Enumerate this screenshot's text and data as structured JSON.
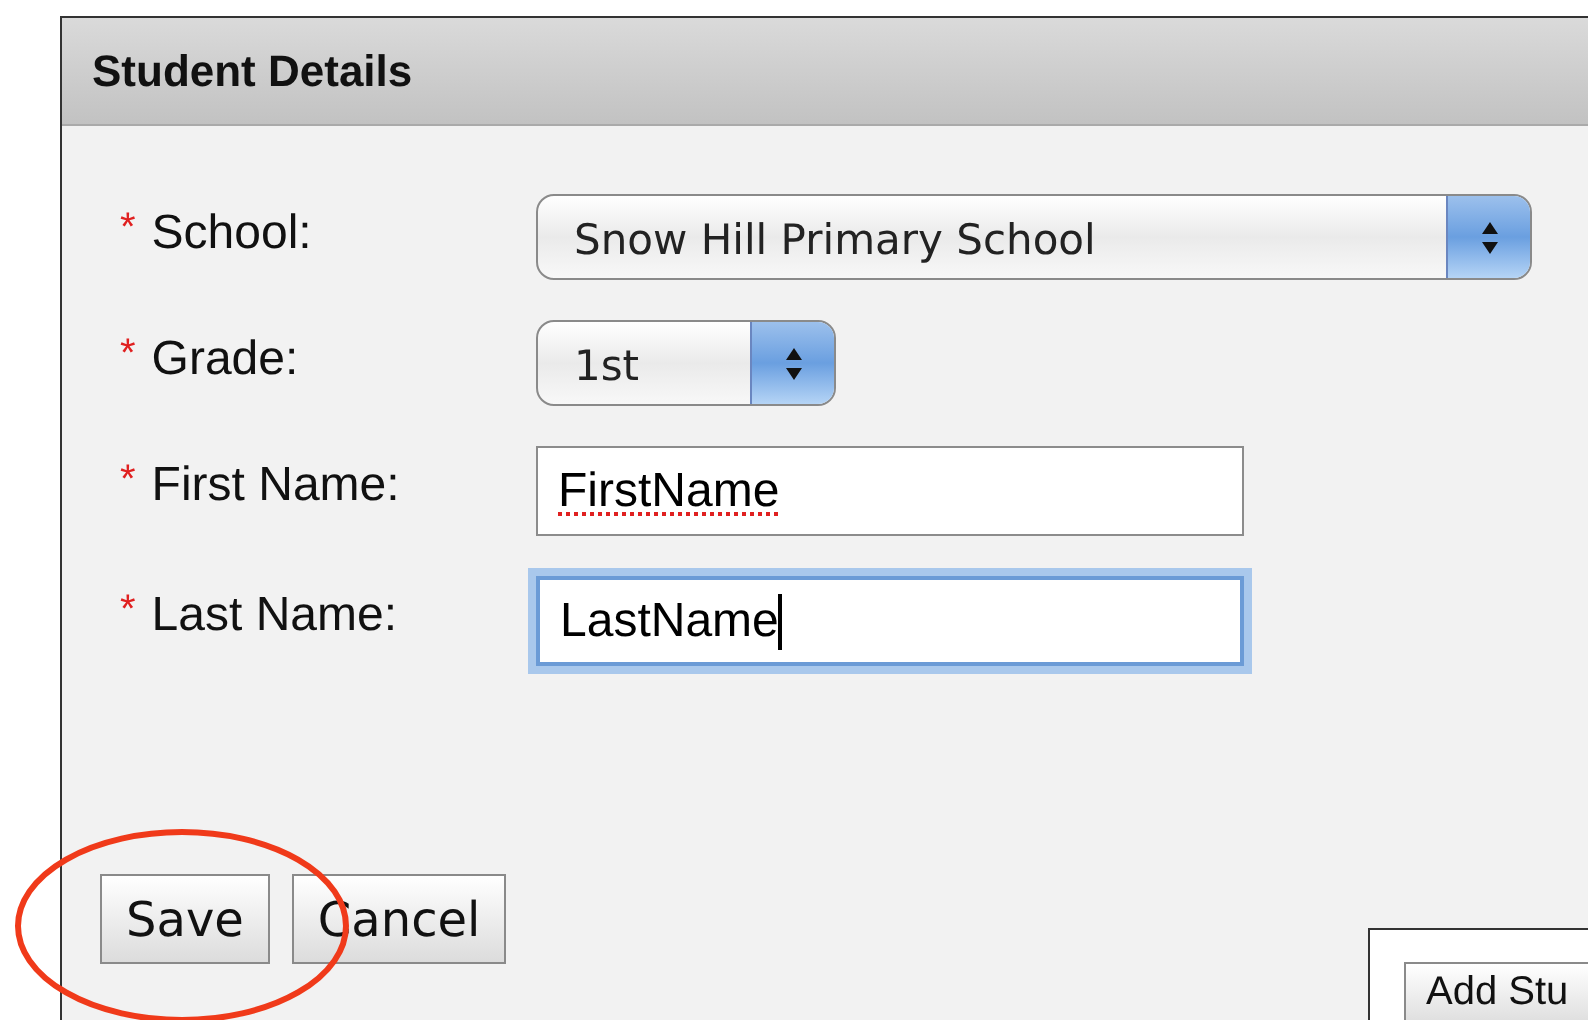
{
  "panel": {
    "title": "Student Details"
  },
  "fields": [
    {
      "kind": "select",
      "label": "School:",
      "required": true,
      "value": "Snow Hill Primary School"
    },
    {
      "kind": "select",
      "label": "Grade:",
      "required": true,
      "value": "1st"
    },
    {
      "kind": "text",
      "label": "First Name:",
      "required": true,
      "value": "FirstName",
      "focused": false,
      "spelling_error": true
    },
    {
      "kind": "text",
      "label": "Last Name:",
      "required": true,
      "value": "LastName",
      "focused": true,
      "spelling_error": false
    }
  ],
  "required_mark": "*",
  "buttons": [
    {
      "label": "Save"
    },
    {
      "label": "Cancel"
    }
  ],
  "side_panel": {
    "button": "Add Stu"
  },
  "annotations": [
    {
      "kind": "ellipse",
      "color": "#f03a1a"
    }
  ]
}
